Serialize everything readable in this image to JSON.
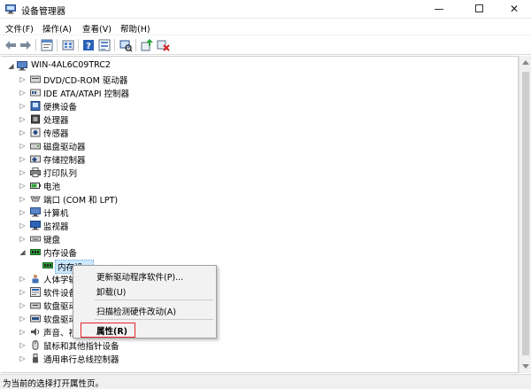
{
  "window": {
    "title": "设备管理器",
    "minimize_glyph": "—",
    "maximize_glyph": "☐",
    "close_glyph": "✕"
  },
  "menubar": {
    "items": [
      {
        "label": "文件(F)"
      },
      {
        "label": "操作(A)"
      },
      {
        "label": "查看(V)"
      },
      {
        "label": "帮助(H)"
      }
    ]
  },
  "toolbar": {
    "buttons": [
      "back-arrow-icon",
      "forward-arrow-icon",
      "properties-sheet-icon",
      "show-hidden-icon",
      "help-icon",
      "device-view-icon",
      "scan-hardware-icon",
      "update-driver-icon",
      "uninstall-device-icon"
    ]
  },
  "tree": {
    "root": {
      "label": "WIN-4AL6C09TRC2",
      "expander": "◢"
    },
    "collapsed_glyph": "▷",
    "expanded_glyph": "◢",
    "categories": [
      {
        "label": "DVD/CD-ROM 驱动器",
        "icon": "dvd-drive-icon"
      },
      {
        "label": "IDE ATA/ATAPI 控制器",
        "icon": "ide-controller-icon"
      },
      {
        "label": "便携设备",
        "icon": "portable-device-icon"
      },
      {
        "label": "处理器",
        "icon": "processor-icon"
      },
      {
        "label": "传感器",
        "icon": "sensor-icon"
      },
      {
        "label": "磁盘驱动器",
        "icon": "disk-drive-icon"
      },
      {
        "label": "存储控制器",
        "icon": "storage-controller-icon"
      },
      {
        "label": "打印队列",
        "icon": "print-queue-icon"
      },
      {
        "label": "电池",
        "icon": "battery-icon"
      },
      {
        "label": "端口 (COM 和 LPT)",
        "icon": "port-icon"
      },
      {
        "label": "计算机",
        "icon": "computer-icon"
      },
      {
        "label": "监视器",
        "icon": "monitor-icon"
      },
      {
        "label": "键盘",
        "icon": "keyboard-icon"
      },
      {
        "label": "内存设备",
        "icon": "memory-device-icon",
        "expanded": true
      },
      {
        "label": "内存设...",
        "icon": "memory-chip-icon",
        "child": true,
        "selected": true
      },
      {
        "label": "人体学输入设备",
        "icon": "hid-icon"
      },
      {
        "label": "软件设备",
        "icon": "software-device-icon"
      },
      {
        "label": "软盘驱动器",
        "icon": "floppy-drive-icon"
      },
      {
        "label": "软盘驱动器控制器",
        "icon": "floppy-controller-icon"
      },
      {
        "label": "声音、视频和游戏控制器",
        "icon": "sound-icon"
      },
      {
        "label": "鼠标和其他指针设备",
        "icon": "mouse-icon"
      },
      {
        "label": "通用串行总线控制器",
        "icon": "usb-icon"
      }
    ]
  },
  "context_menu": {
    "items": [
      {
        "label": "更新驱动程序软件(P)..."
      },
      {
        "label": "卸载(U)"
      },
      {
        "label": "扫描检测硬件改动(A)"
      },
      {
        "label": "属性(R)"
      }
    ],
    "highlight_color": "#e5262b"
  },
  "statusbar": {
    "text": "为当前的选择打开属性页。"
  },
  "colors": {
    "selection": "#cce8ff",
    "accent_blue": "#1f5fbf"
  }
}
